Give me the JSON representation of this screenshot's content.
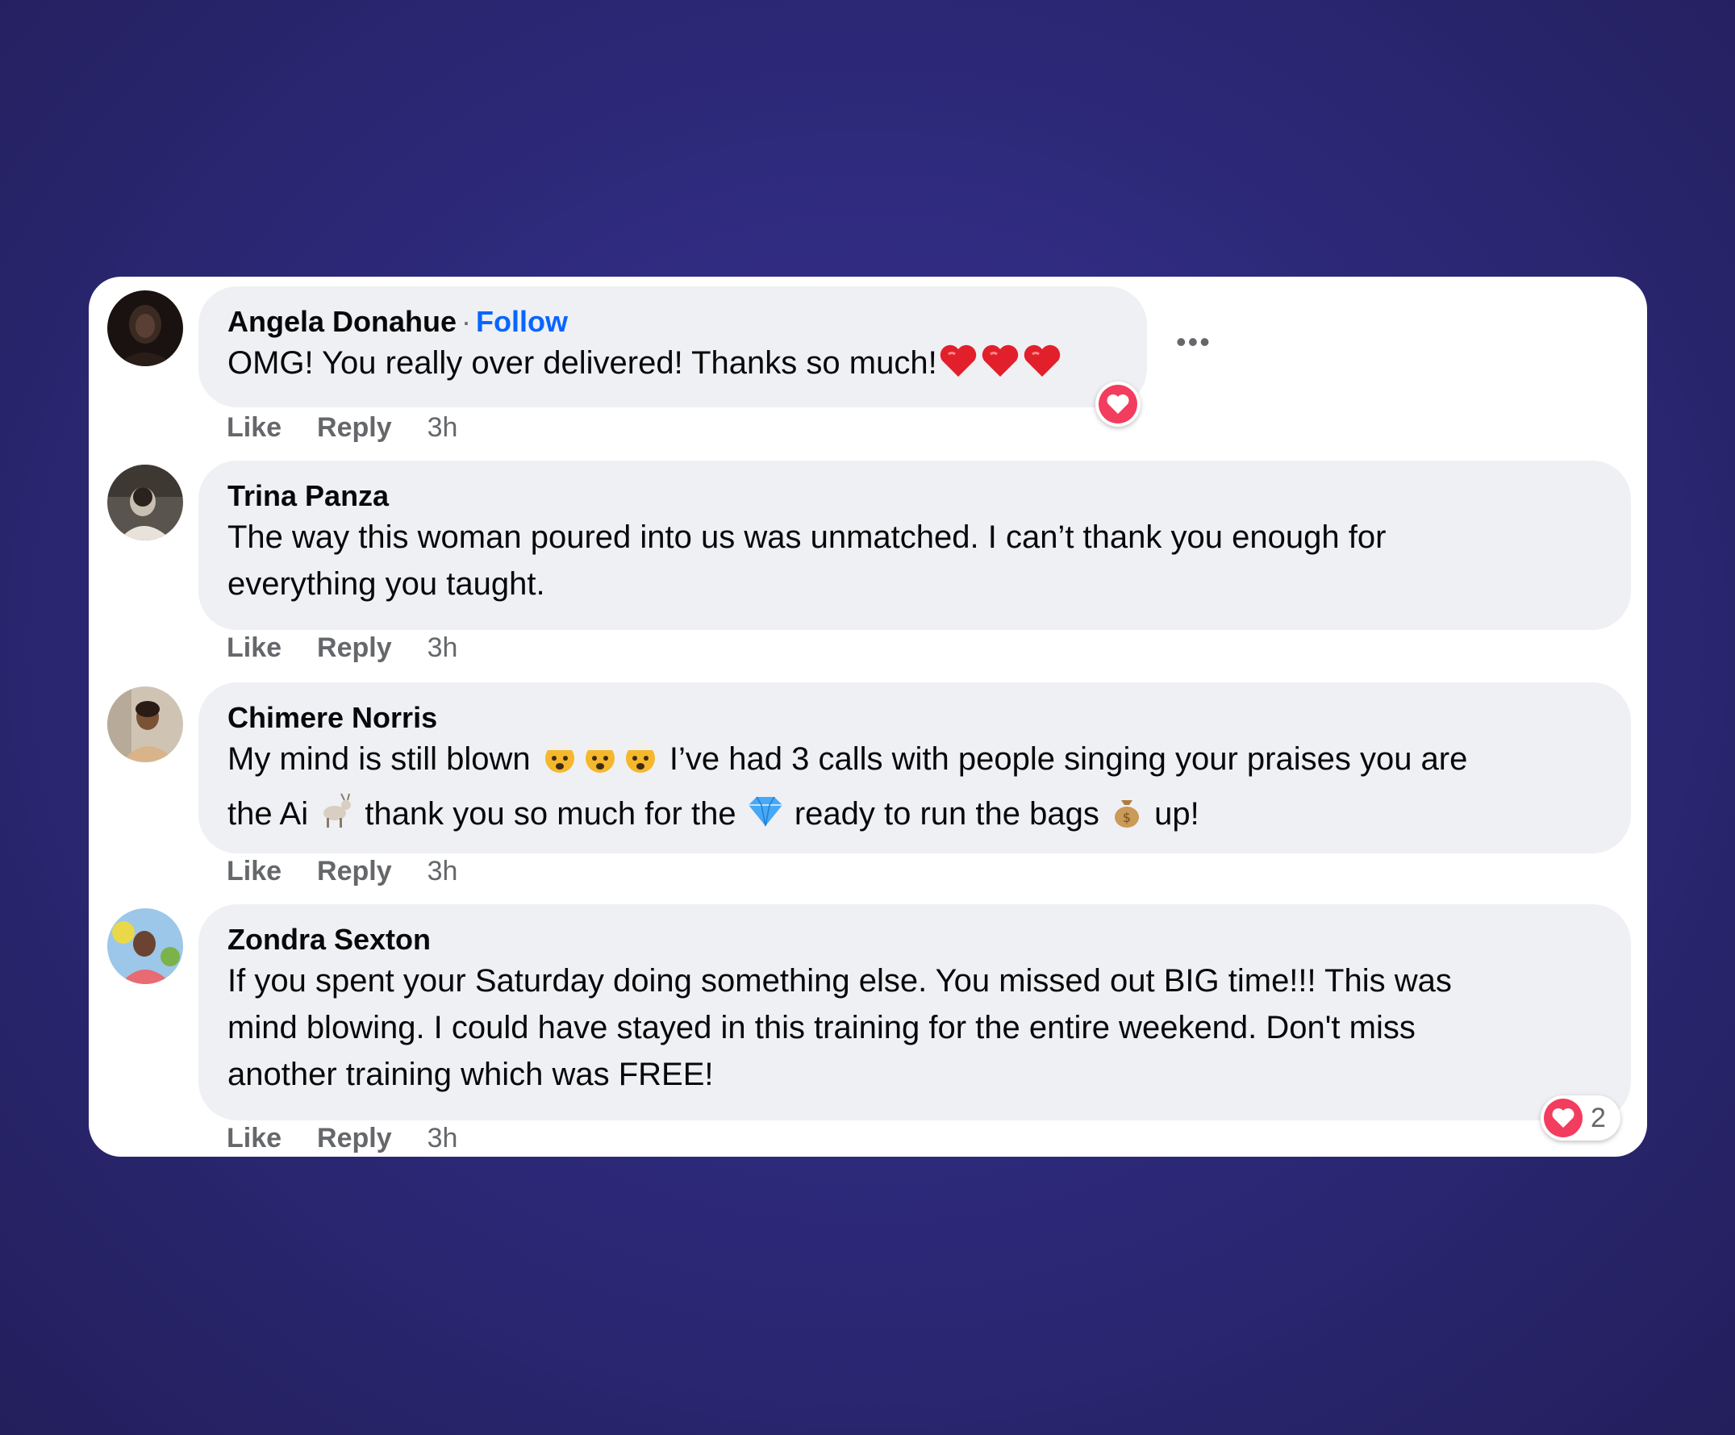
{
  "comments": [
    {
      "author": "Angela Donahue",
      "separator": "·",
      "follow_label": "Follow",
      "text": "OMG! You really over delivered! Thanks so much!",
      "emoji": [
        "red-heart",
        "red-heart",
        "red-heart"
      ],
      "actions": {
        "like": "Like",
        "reply": "Reply",
        "time": "3h"
      },
      "reaction": {
        "type": "love"
      }
    },
    {
      "author": "Trina Panza",
      "text_lines": [
        "The way this woman poured into us was unmatched. I can’t thank you enough for",
        "everything you taught."
      ],
      "actions": {
        "like": "Like",
        "reply": "Reply",
        "time": "3h"
      }
    },
    {
      "author": "Chimere Norris",
      "segments": {
        "a": "My mind is still blown",
        "b": "I’ve had 3 calls with people singing your praises you are",
        "c": "the Ai",
        "d": "thank you so much for the",
        "e": "ready to run the bags",
        "f": "up!"
      },
      "emoji": [
        "exploding-head",
        "exploding-head",
        "exploding-head",
        "goat",
        "gem",
        "money-bag"
      ],
      "actions": {
        "like": "Like",
        "reply": "Reply",
        "time": "3h"
      }
    },
    {
      "author": "Zondra Sexton",
      "text_lines": [
        "If you spent your Saturday doing something else. You missed out BIG time!!! This was",
        "mind blowing. I could have stayed in this training for the entire weekend. Don't miss",
        "another training which was FREE!"
      ],
      "actions": {
        "like": "Like",
        "reply": "Reply",
        "time": "3h"
      },
      "reaction": {
        "type": "love",
        "count": "2"
      }
    }
  ],
  "more_label": "•••",
  "colors": {
    "accent": "#0866ff",
    "love": "#f23d5f",
    "bubble": "#eff0f4",
    "background": "#2e2a7c"
  }
}
